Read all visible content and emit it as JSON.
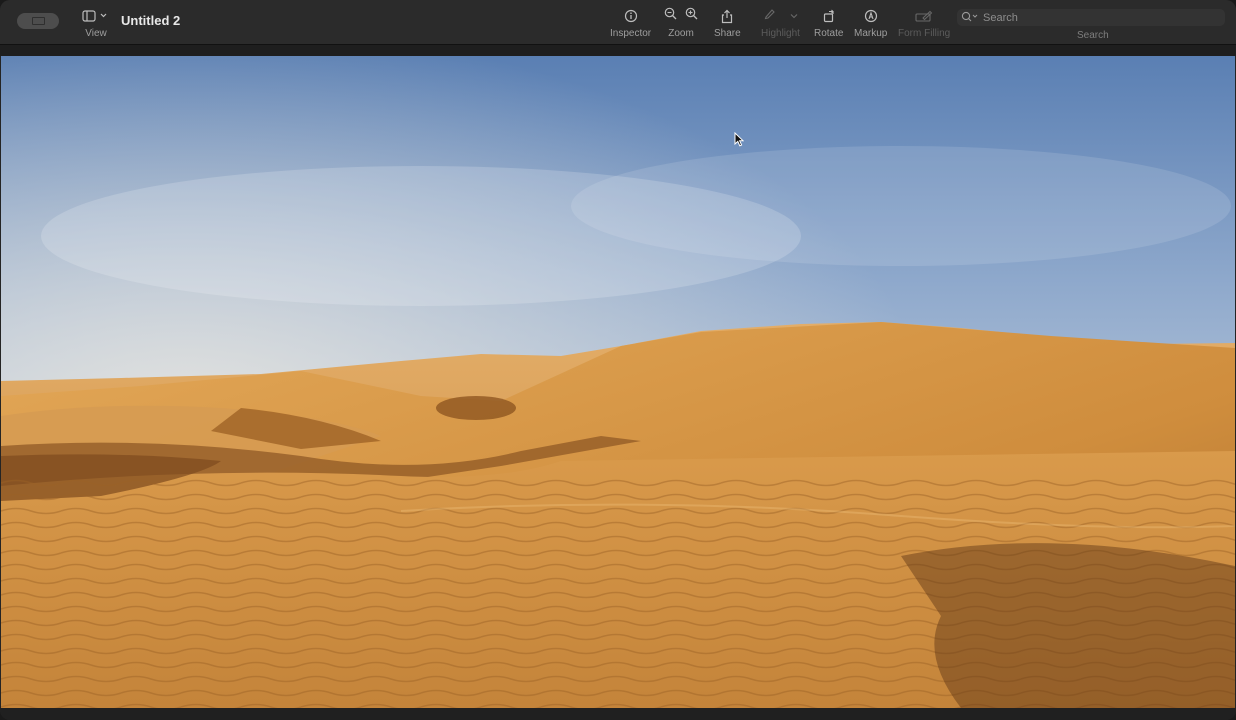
{
  "window": {
    "title": "Untitled 2"
  },
  "toolbar": {
    "view": {
      "label": "View",
      "icon": "sidebar-icon"
    },
    "inspector": {
      "label": "Inspector",
      "icon": "info-icon"
    },
    "zoom": {
      "label": "Zoom",
      "icons": [
        "zoom-out-icon",
        "zoom-in-icon"
      ]
    },
    "share": {
      "label": "Share",
      "icon": "share-icon"
    },
    "highlight": {
      "label": "Highlight",
      "icon": "highlighter-icon",
      "enabled": false
    },
    "rotate": {
      "label": "Rotate",
      "icon": "rotate-icon"
    },
    "markup": {
      "label": "Markup",
      "icon": "markup-pen-icon"
    },
    "form_filling": {
      "label": "Form Filling",
      "icon": "form-fill-icon",
      "enabled": false
    },
    "search": {
      "placeholder": "Search",
      "label": "Search",
      "icon": "magnifier-icon"
    }
  },
  "document": {
    "image_subject": "desert-sand-dunes-photo",
    "colors": {
      "sky_top": "#5f82b4",
      "sky_mid": "#a9bfd9",
      "sky_horizon": "#d9dde0",
      "sand_light": "#e0a35a",
      "sand_mid": "#c98a3e",
      "sand_shadow": "#8e5a24"
    }
  }
}
